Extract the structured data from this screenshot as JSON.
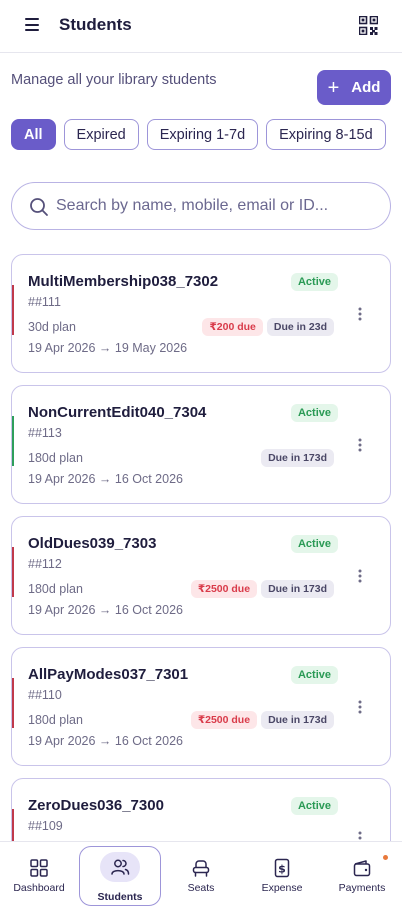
{
  "header": {
    "title": "Students",
    "menu_icon": "hamburger-icon",
    "qr_icon": "qr-code-icon"
  },
  "subtitle": "Manage all your library students",
  "add_button": {
    "label": "Add",
    "icon": "plus-icon"
  },
  "filters": [
    {
      "label": "All",
      "active": true
    },
    {
      "label": "Expired",
      "active": false
    },
    {
      "label": "Expiring 1-7d",
      "active": false
    },
    {
      "label": "Expiring 8-15d",
      "active": false
    }
  ],
  "search": {
    "placeholder": "Search by name, mobile, email or ID...",
    "value": ""
  },
  "students": [
    {
      "name": "MultiMembership038_7302",
      "id": "##111",
      "plan": "30d plan",
      "dates": "19 Apr 2026 → 19 May 2026",
      "status": "Active",
      "due": "₹200 due",
      "due_in": "Due in 23d"
    },
    {
      "name": "NonCurrentEdit040_7304",
      "id": "##113",
      "plan": "180d plan",
      "dates": "19 Apr 2026 → 16 Oct 2026",
      "status": "Active",
      "due": "",
      "due_in": "Due in 173d"
    },
    {
      "name": "OldDues039_7303",
      "id": "##112",
      "plan": "180d plan",
      "dates": "19 Apr 2026 → 16 Oct 2026",
      "status": "Active",
      "due": "₹2500 due",
      "due_in": "Due in 173d"
    },
    {
      "name": "AllPayModes037_7301",
      "id": "##110",
      "plan": "180d plan",
      "dates": "19 Apr 2026 → 16 Oct 2026",
      "status": "Active",
      "due": "₹2500 due",
      "due_in": "Due in 173d"
    },
    {
      "name": "ZeroDues036_7300",
      "id": "##109",
      "plan": "",
      "dates": "",
      "status": "Active",
      "due": "",
      "due_in": ""
    }
  ],
  "colors": {
    "accent": "#6a5cc9",
    "active_green": "#2a9a55",
    "due_red": "#d93b4a"
  },
  "bottom_nav": [
    {
      "label": "Dashboard",
      "icon": "dashboard-icon",
      "active": false
    },
    {
      "label": "Students",
      "icon": "users-icon",
      "active": true
    },
    {
      "label": "Seats",
      "icon": "seat-icon",
      "active": false
    },
    {
      "label": "Expense",
      "icon": "receipt-icon",
      "active": false
    },
    {
      "label": "Payments",
      "icon": "wallet-icon",
      "active": false
    }
  ]
}
